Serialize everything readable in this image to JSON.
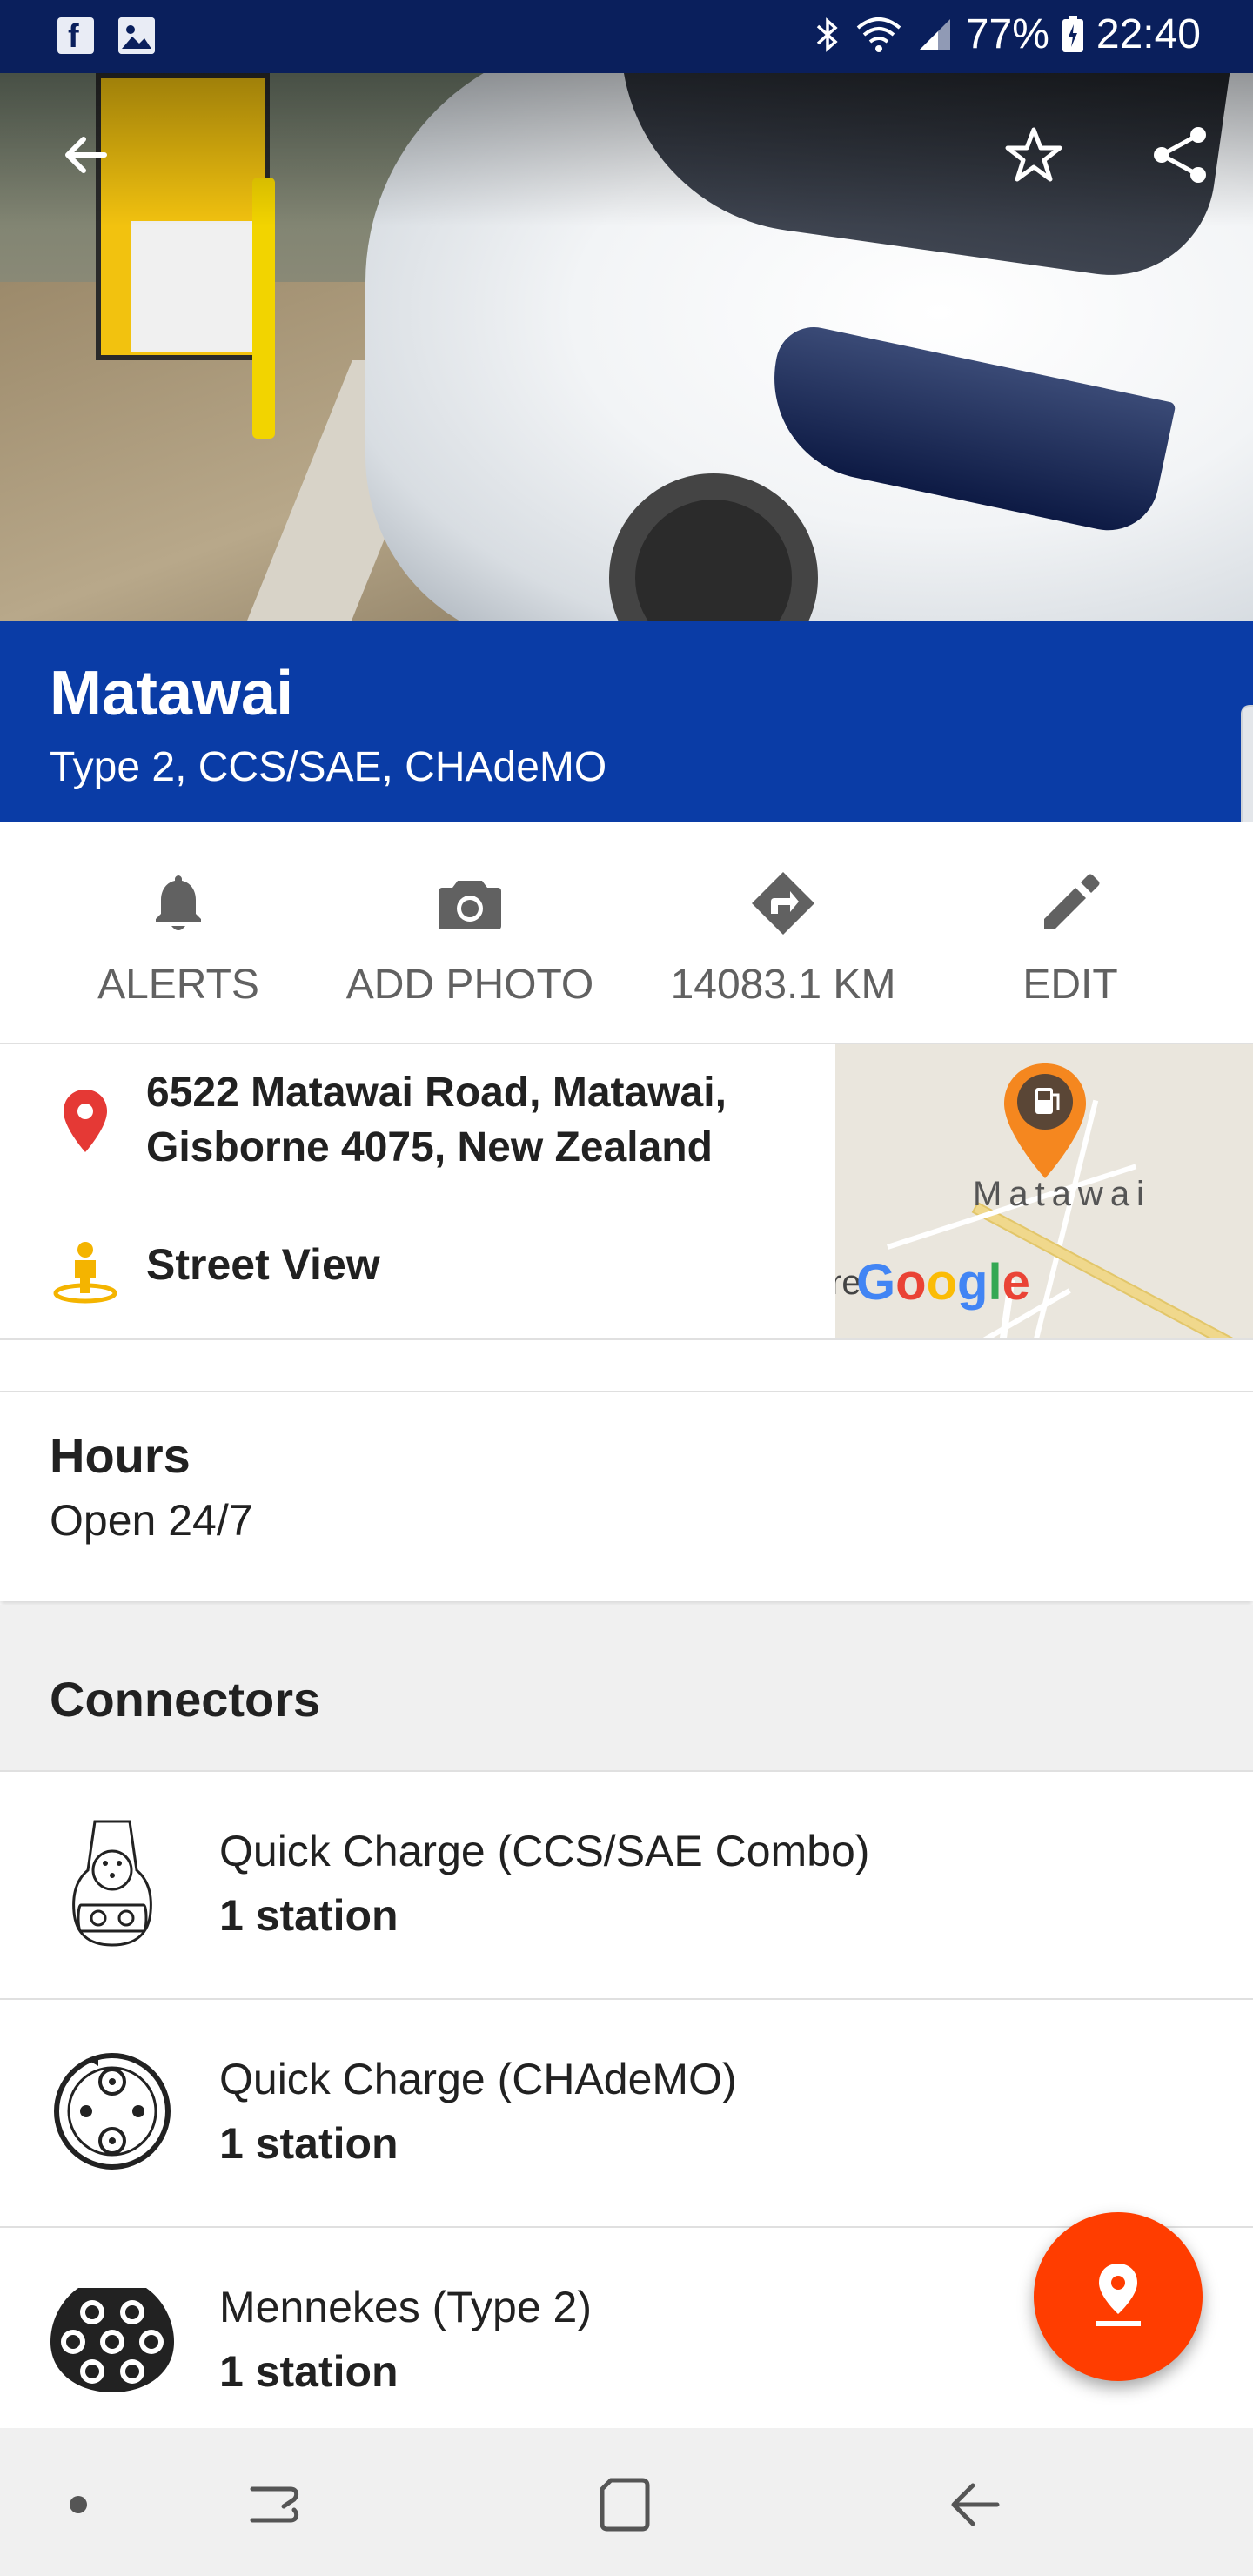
{
  "status_bar": {
    "battery": "77%",
    "time": "22:40",
    "left_icons": [
      "facebook-icon",
      "gallery-icon"
    ],
    "right_icons": [
      "bluetooth-icon",
      "wifi-icon",
      "cell-signal-icon",
      "battery-icon"
    ]
  },
  "header": {
    "icons": [
      "back-arrow-icon",
      "star-icon",
      "share-icon"
    ]
  },
  "station": {
    "name": "Matawai",
    "connector_types": "Type 2, CCS/SAE, CHAdeMO"
  },
  "actions": [
    {
      "label": "ALERTS",
      "icon": "bell-icon"
    },
    {
      "label": "ADD PHOTO",
      "icon": "camera-icon"
    },
    {
      "label": "14083.1 KM",
      "icon": "directions-icon"
    },
    {
      "label": "EDIT",
      "icon": "pencil-icon"
    }
  ],
  "address": {
    "line1": "6522 Matawai Road, Matawai,",
    "line2": "Gisborne 4075, New Zealand",
    "street_view": "Street View"
  },
  "map": {
    "place_label": "Matawai",
    "partial_label": "re",
    "logo": "Google"
  },
  "hours": {
    "label": "Hours",
    "value": "Open 24/7"
  },
  "connectors": {
    "heading": "Connectors",
    "items": [
      {
        "name": "Quick Charge (CCS/SAE Combo)",
        "count": "1 station",
        "icon": "ccs-combo-connector-icon"
      },
      {
        "name": "Quick Charge (CHAdeMO)",
        "count": "1 station",
        "icon": "chademo-connector-icon"
      },
      {
        "name": "Mennekes (Type 2)",
        "count": "1 station",
        "icon": "type2-connector-icon"
      }
    ]
  },
  "colors": {
    "status_bar": "#0a1f5c",
    "banner": "#0a3ca6",
    "fab": "#ff3d00",
    "pin_red": "#e53935",
    "map_marker": "#f5871f",
    "street_view_yellow": "#f4b400"
  },
  "nav_bar": {
    "icons": [
      "dot-icon",
      "recent-apps-icon",
      "home-icon",
      "back-icon"
    ]
  }
}
